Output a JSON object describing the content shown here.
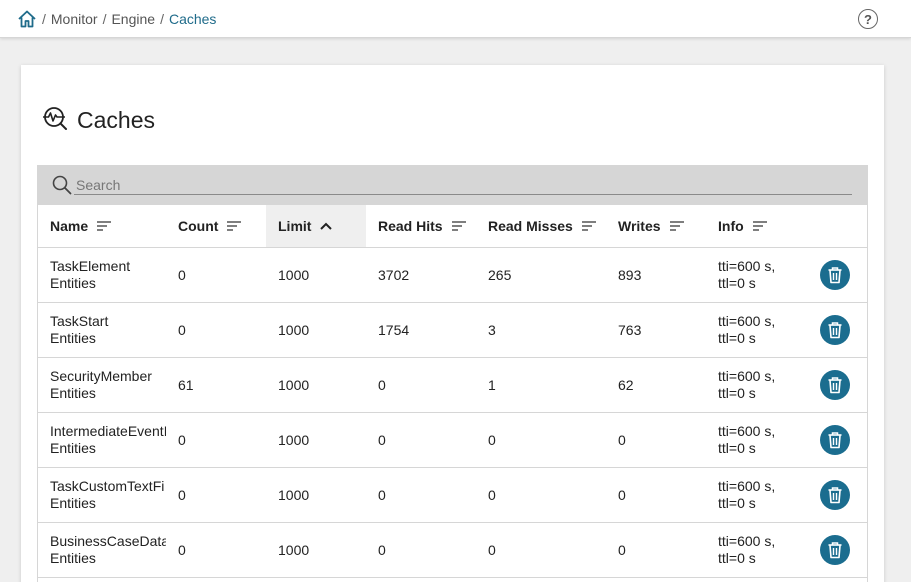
{
  "breadcrumb": {
    "home_icon": "home-icon",
    "items": [
      "Monitor",
      "Engine",
      "Caches"
    ],
    "separator": "/"
  },
  "help": {
    "icon": "help-icon",
    "label": "?"
  },
  "page": {
    "title": "Caches",
    "title_icon": "cache-monitor-icon"
  },
  "search": {
    "placeholder": "Search",
    "value": ""
  },
  "table": {
    "columns": [
      "Name",
      "Count",
      "Limit",
      "Read Hits",
      "Read Misses",
      "Writes",
      "Info"
    ],
    "sorted_column": "Limit",
    "sort_direction": "ascending",
    "rows": [
      {
        "name1": "TaskElement",
        "name2": "Entities",
        "count": "0",
        "limit": "1000",
        "read_hits": "3702",
        "read_misses": "265",
        "writes": "893",
        "info1": "tti=600 s,",
        "info2": "ttl=0 s"
      },
      {
        "name1": "TaskStart",
        "name2": "Entities",
        "count": "0",
        "limit": "1000",
        "read_hits": "1754",
        "read_misses": "3",
        "writes": "763",
        "info1": "tti=600 s,",
        "info2": "ttl=0 s"
      },
      {
        "name1": "SecurityMember",
        "name2": "Entities",
        "count": "61",
        "limit": "1000",
        "read_hits": "0",
        "read_misses": "1",
        "writes": "62",
        "info1": "tti=600 s,",
        "info2": "ttl=0 s"
      },
      {
        "name1": "IntermediateEventI",
        "name2": "Entities",
        "count": "0",
        "limit": "1000",
        "read_hits": "0",
        "read_misses": "0",
        "writes": "0",
        "info1": "tti=600 s,",
        "info2": "ttl=0 s"
      },
      {
        "name1": "TaskCustomTextFi",
        "name2": "Entities",
        "count": "0",
        "limit": "1000",
        "read_hits": "0",
        "read_misses": "0",
        "writes": "0",
        "info1": "tti=600 s,",
        "info2": "ttl=0 s"
      },
      {
        "name1": "BusinessCaseData",
        "name2": "Entities",
        "count": "0",
        "limit": "1000",
        "read_hits": "0",
        "read_misses": "0",
        "writes": "0",
        "info1": "tti=600 s,",
        "info2": "ttl=0 s"
      }
    ]
  },
  "colors": {
    "accent": "#1f6b8a",
    "delete_button": "#1b6d8f",
    "search_bg": "#d6d6d6"
  }
}
